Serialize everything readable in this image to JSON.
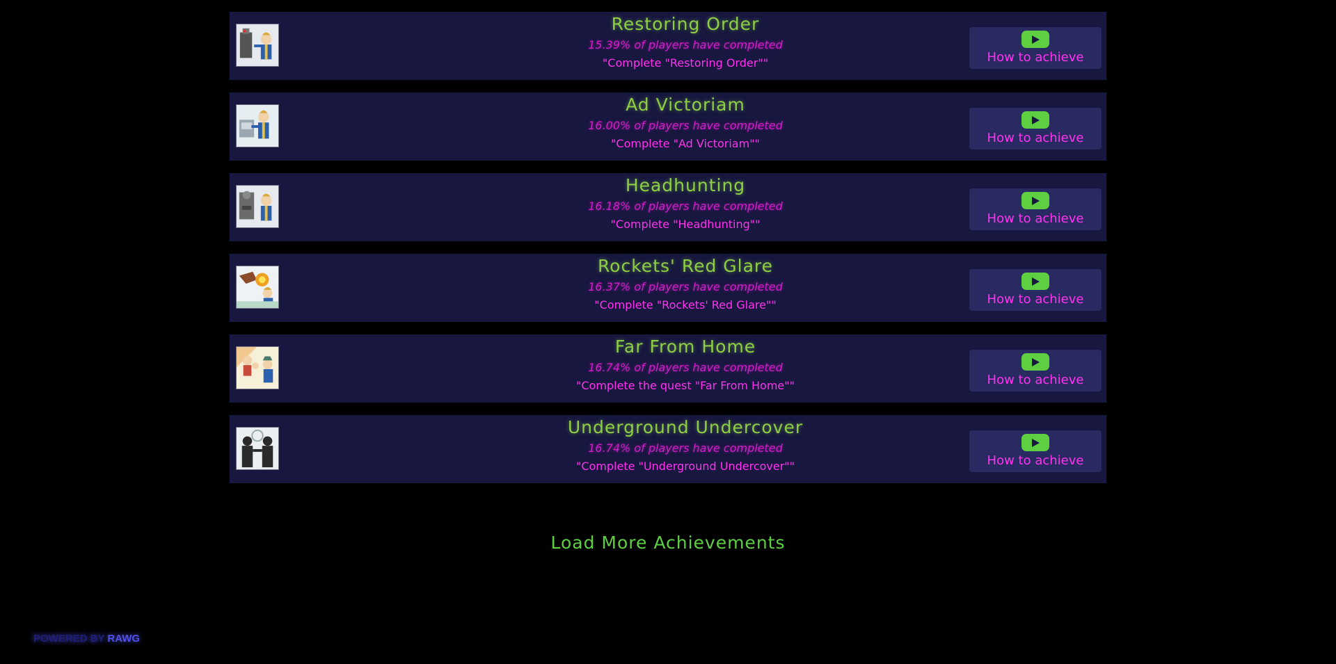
{
  "colors": {
    "background": "#000000",
    "card": "#17173f",
    "title": "#8ece45",
    "percent": "#d21ec8",
    "description": "#ff33ee",
    "button_bg": "#2a2a62",
    "play": "#5fcf42",
    "load_more": "#5fcf42"
  },
  "achievements": [
    {
      "title": "Restoring Order",
      "percent": "15.39% of players have completed",
      "description": "\"Complete \"Restoring Order\"\"",
      "button_label": "How to achieve",
      "icon": "vault-boy-robot-icon"
    },
    {
      "title": "Ad Victoriam",
      "percent": "16.00% of players have completed",
      "description": "\"Complete \"Ad Victoriam\"\"",
      "button_label": "How to achieve",
      "icon": "vault-boy-computer-icon"
    },
    {
      "title": "Headhunting",
      "percent": "16.18% of players have completed",
      "description": "\"Complete \"Headhunting\"\"",
      "button_label": "How to achieve",
      "icon": "vault-boy-robot-icon"
    },
    {
      "title": "Rockets' Red Glare",
      "percent": "16.37% of players have completed",
      "description": "\"Complete \"Rockets' Red Glare\"\"",
      "button_label": "How to achieve",
      "icon": "vault-boy-explosion-icon"
    },
    {
      "title": "Far From Home",
      "percent": "16.74% of players have completed",
      "description": "\"Complete the quest \"Far From Home\"\"",
      "button_label": "How to achieve",
      "icon": "vault-boy-family-icon"
    },
    {
      "title": "Underground Undercover",
      "percent": "16.74% of players have completed",
      "description": "\"Complete \"Underground Undercover\"\"",
      "button_label": "How to achieve",
      "icon": "vault-boy-silhouettes-icon"
    }
  ],
  "load_more": {
    "label": "Load More Achievements"
  },
  "footer": {
    "powered_by": "POWERED BY",
    "brand": "RAWG"
  }
}
